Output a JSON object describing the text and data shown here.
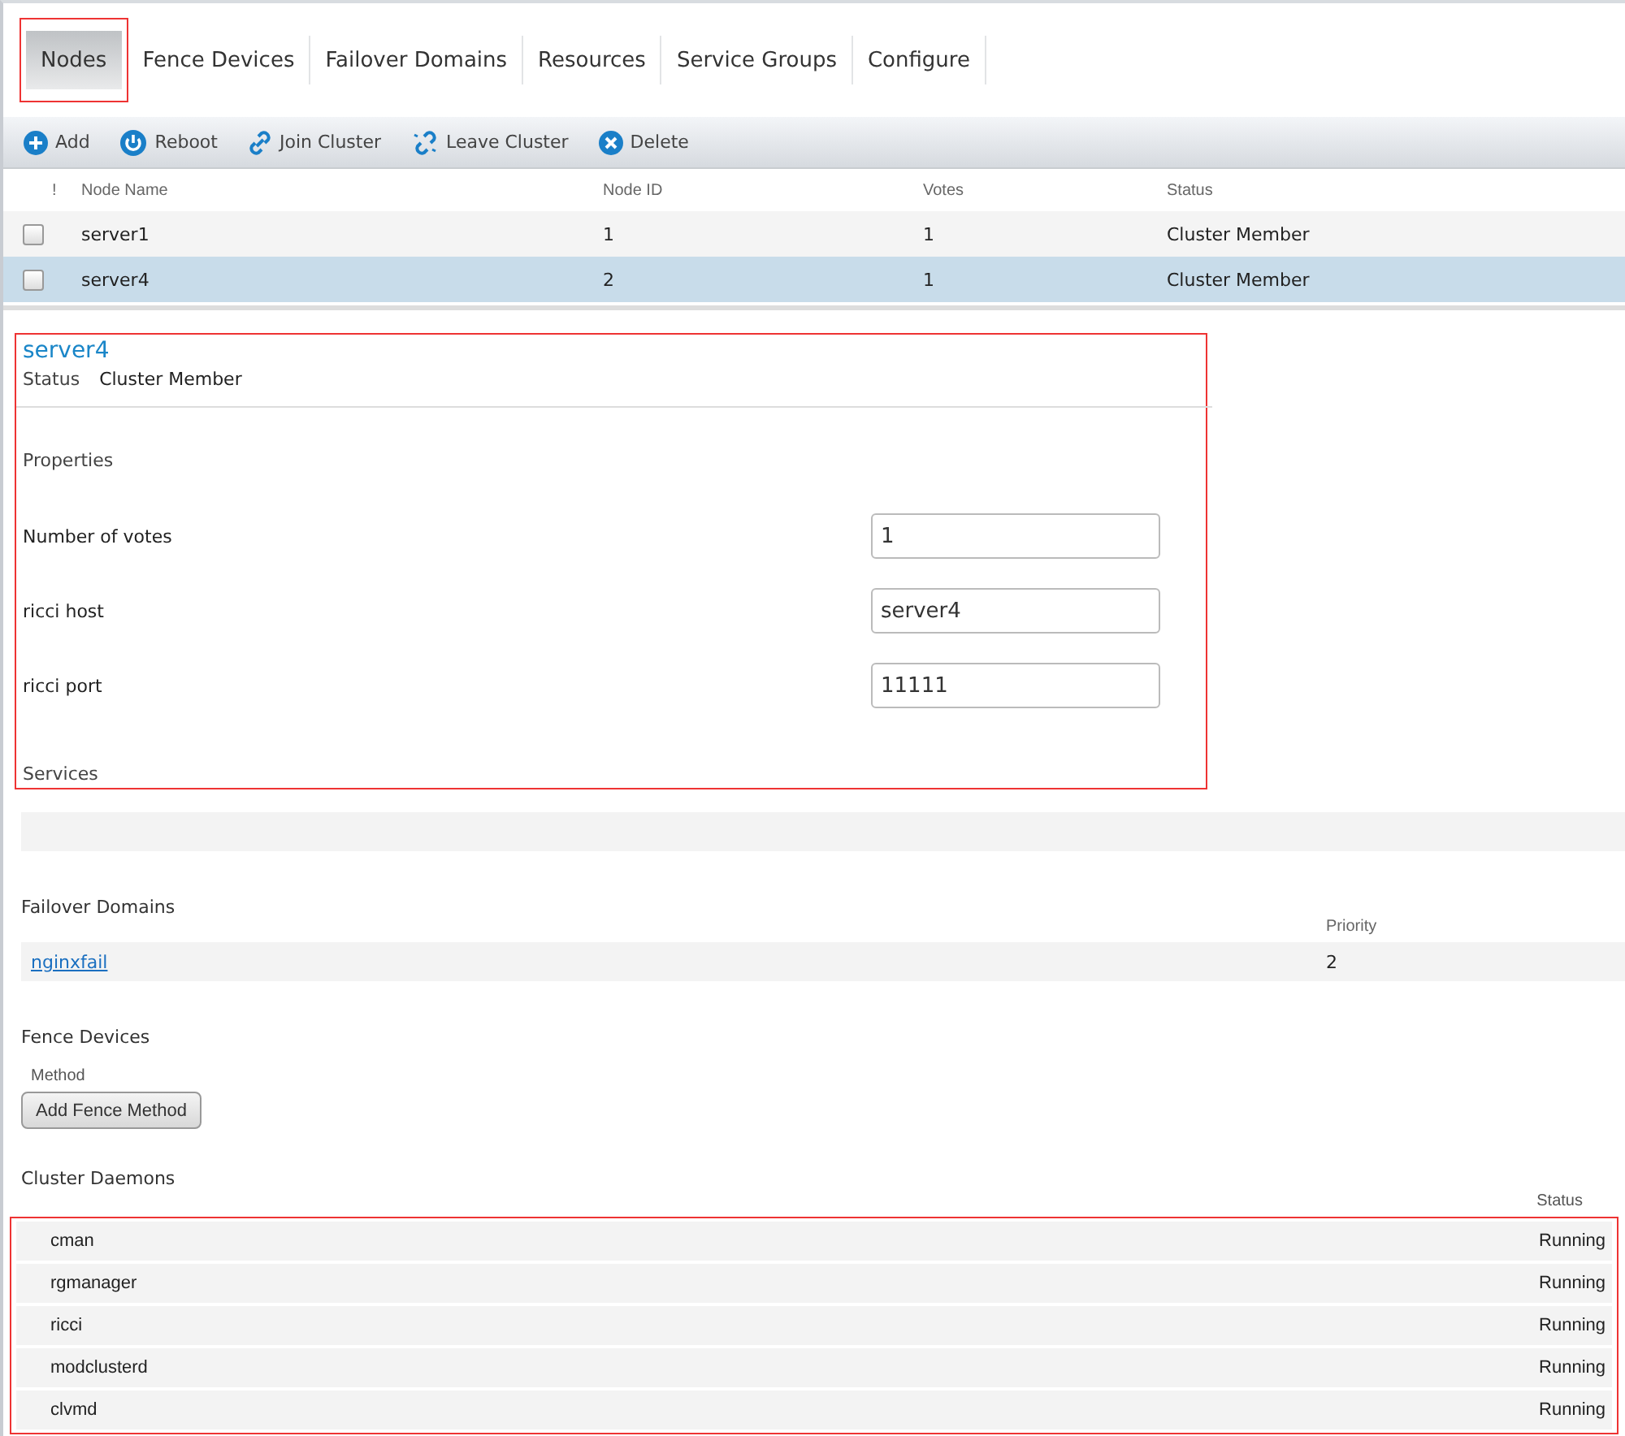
{
  "tabs": [
    {
      "label": "Nodes",
      "selected": true,
      "highlighted": true
    },
    {
      "label": "Fence Devices",
      "selected": false,
      "highlighted": false
    },
    {
      "label": "Failover Domains",
      "selected": false,
      "highlighted": false
    },
    {
      "label": "Resources",
      "selected": false,
      "highlighted": false
    },
    {
      "label": "Service Groups",
      "selected": false,
      "highlighted": false
    },
    {
      "label": "Configure",
      "selected": false,
      "highlighted": false
    }
  ],
  "toolbar": [
    {
      "label": "Add",
      "kind": "add"
    },
    {
      "label": "Reboot",
      "kind": "reboot"
    },
    {
      "label": "Join Cluster",
      "kind": "join"
    },
    {
      "label": "Leave Cluster",
      "kind": "leave"
    },
    {
      "label": "Delete",
      "kind": "delete"
    }
  ],
  "nodes_table": {
    "columns": [
      "!",
      "Node Name",
      "Node ID",
      "Votes",
      "Status"
    ],
    "rows": [
      {
        "checked": false,
        "selected": false,
        "cells": [
          "",
          "server1",
          "1",
          "1",
          "Cluster Member"
        ]
      },
      {
        "checked": false,
        "selected": true,
        "cells": [
          "",
          "server4",
          "2",
          "1",
          "Cluster Member"
        ]
      }
    ]
  },
  "detail": {
    "highlighted": true,
    "title": "server4",
    "status_label": "Status",
    "status_value": "Cluster Member",
    "properties_heading": "Properties",
    "properties": [
      {
        "label": "Number of votes",
        "value": "1"
      },
      {
        "label": "ricci host",
        "value": "server4"
      },
      {
        "label": "ricci port",
        "value": "11111"
      }
    ],
    "services_heading": "Services"
  },
  "failover_domains": {
    "heading": "Failover Domains",
    "priority_header": "Priority",
    "rows": [
      {
        "name": "nginxfail",
        "priority": "2"
      }
    ]
  },
  "fence_devices": {
    "heading": "Fence Devices",
    "method_label": "Method",
    "button": "Add Fence Method"
  },
  "daemons": {
    "heading": "Cluster Daemons",
    "status_header": "Status",
    "highlighted": true,
    "rows": [
      {
        "name": "cman",
        "status": "Running"
      },
      {
        "name": "rgmanager",
        "status": "Running"
      },
      {
        "name": "ricci",
        "status": "Running"
      },
      {
        "name": "modclusterd",
        "status": "Running"
      },
      {
        "name": "clvmd",
        "status": "Running"
      }
    ]
  }
}
